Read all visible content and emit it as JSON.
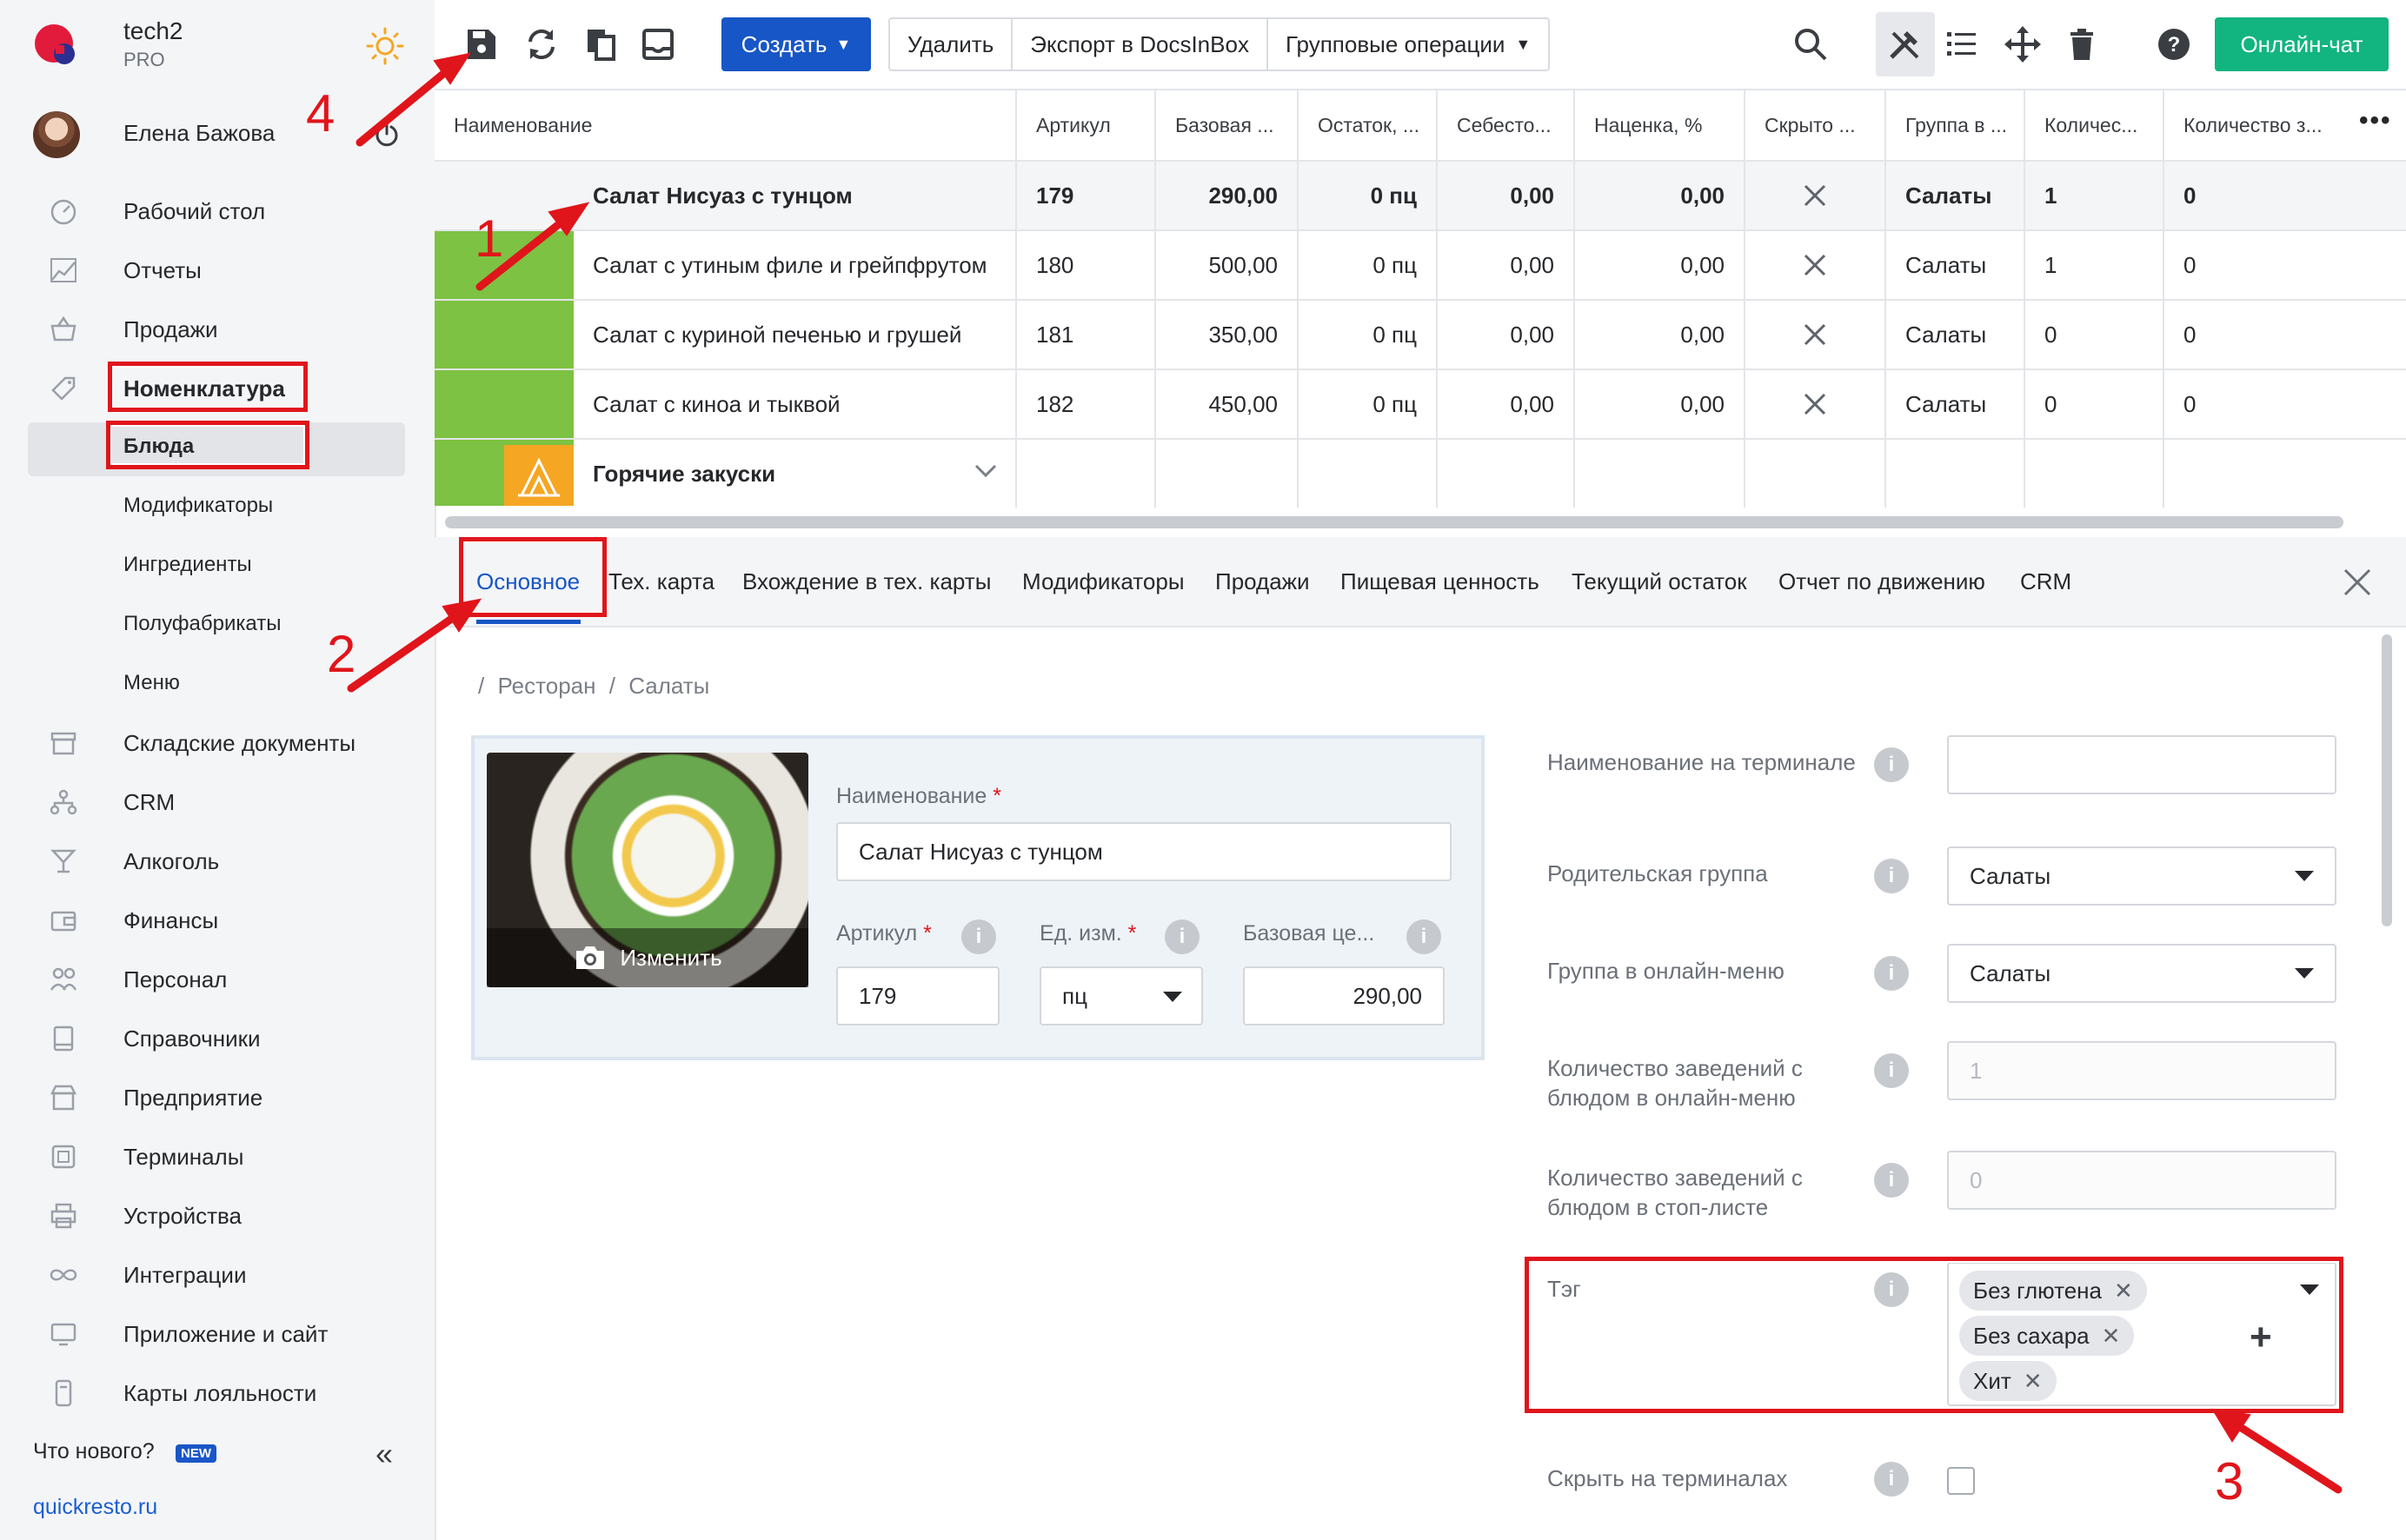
{
  "app": {
    "brand": "tech2",
    "plan": "PRO",
    "user": "Елена Бажова"
  },
  "sidebar": {
    "items": [
      {
        "label": "Рабочий стол",
        "icon": "dashboard-icon"
      },
      {
        "label": "Отчеты",
        "icon": "reports-icon"
      },
      {
        "label": "Продажи",
        "icon": "sales-basket-icon"
      },
      {
        "label": "Номенклатура",
        "icon": "tag-icon"
      },
      {
        "label": "Складские документы",
        "icon": "warehouse-icon"
      },
      {
        "label": "CRM",
        "icon": "crm-icon"
      },
      {
        "label": "Алкоголь",
        "icon": "glass-icon"
      },
      {
        "label": "Финансы",
        "icon": "wallet-icon"
      },
      {
        "label": "Персонал",
        "icon": "staff-icon"
      },
      {
        "label": "Справочники",
        "icon": "book-icon"
      },
      {
        "label": "Предприятие",
        "icon": "store-icon"
      },
      {
        "label": "Терминалы",
        "icon": "terminal-icon"
      },
      {
        "label": "Устройства",
        "icon": "printer-icon"
      },
      {
        "label": "Интеграции",
        "icon": "infinity-icon"
      },
      {
        "label": "Приложение и сайт",
        "icon": "app-icon"
      },
      {
        "label": "Карты лояльности",
        "icon": "card-icon"
      }
    ],
    "subitems": [
      "Блюда",
      "Модификаторы",
      "Ингредиенты",
      "Полуфабрикаты",
      "Меню"
    ],
    "whats_new": "Что нового?",
    "new_badge": "NEW",
    "site": "quickresto.ru"
  },
  "toolbar": {
    "create": "Создать",
    "delete": "Удалить",
    "export": "Экспорт в DocsInBox",
    "group_ops": "Групповые операции",
    "chat": "Онлайн-чат"
  },
  "grid": {
    "columns": [
      "Наименование",
      "Артикул",
      "Базовая ...",
      "Остаток, ...",
      "Себесто...",
      "Наценка, %",
      "Скрыто ...",
      "Группа в ...",
      "Количес...",
      "Количество з..."
    ],
    "rows": [
      {
        "name": "Салат Нисуаз с тунцом",
        "sku": "179",
        "price": "290,00",
        "stock": "0 пц",
        "cost": "0,00",
        "markup": "0,00",
        "group": "Салаты",
        "qty": "1",
        "qty2": "0"
      },
      {
        "name": "Салат с утиным филе и грейпфрутом",
        "sku": "180",
        "price": "500,00",
        "stock": "0 пц",
        "cost": "0,00",
        "markup": "0,00",
        "group": "Салаты",
        "qty": "1",
        "qty2": "0"
      },
      {
        "name": "Салат с куриной печенью и грушей",
        "sku": "181",
        "price": "350,00",
        "stock": "0 пц",
        "cost": "0,00",
        "markup": "0,00",
        "group": "Салаты",
        "qty": "0",
        "qty2": "0"
      },
      {
        "name": "Салат с киноа и тыквой",
        "sku": "182",
        "price": "450,00",
        "stock": "0 пц",
        "cost": "0,00",
        "markup": "0,00",
        "group": "Салаты",
        "qty": "0",
        "qty2": "0"
      }
    ],
    "group_row": "Горячие закуски"
  },
  "tabs": [
    "Основное",
    "Тех. карта",
    "Вхождение в тех. карты",
    "Модификаторы",
    "Продажи",
    "Пищевая ценность",
    "Текущий остаток",
    "Отчет по движению",
    "CRM"
  ],
  "breadcrumb": {
    "sep": "/",
    "root": "Ресторан",
    "group": "Салаты"
  },
  "form": {
    "photo_change": "Изменить",
    "name_label": "Наименование",
    "name_value": "Салат Нисуаз с тунцом",
    "sku_label": "Артикул",
    "sku_value": "179",
    "unit_label": "Ед. изм.",
    "unit_value": "пц",
    "price_label": "Базовая це...",
    "price_value": "290,00",
    "required_mark": "*",
    "terminal_name_label": "Наименование на терминале",
    "parent_group_label": "Родительская группа",
    "parent_group_value": "Салаты",
    "online_group_label": "Группа в онлайн-меню",
    "online_group_value": "Салаты",
    "online_count_label": "Количество заведений с блюдом в онлайн-меню",
    "online_count_value": "1",
    "stop_count_label": "Количество заведений с блюдом в стоп-листе",
    "stop_count_value": "0",
    "tag_label": "Тэг",
    "tags": [
      "Без глютена",
      "Без сахара",
      "Хит"
    ],
    "hide_label": "Скрыть на терминалах"
  },
  "annotations": [
    "1",
    "2",
    "3",
    "4"
  ],
  "colors": {
    "accent": "#1756c6",
    "chat": "#12b47f",
    "highlight": "#e0151b",
    "group_green": "#7dc242",
    "group_orange": "#f5a623"
  }
}
